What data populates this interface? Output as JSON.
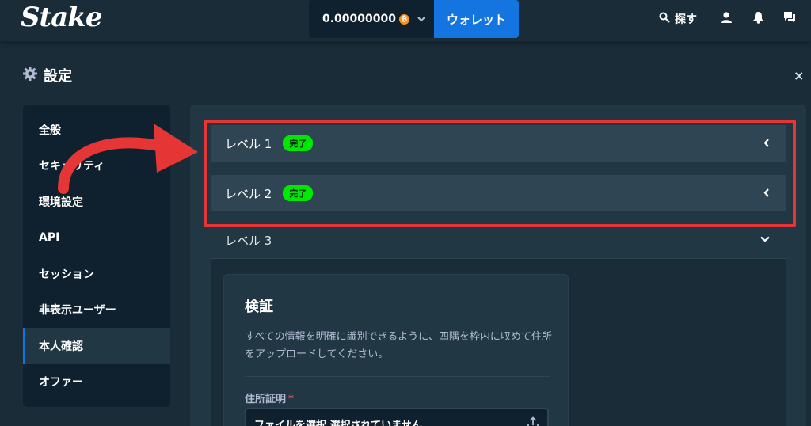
{
  "header": {
    "logo": "Stake",
    "balance": "0.00000000",
    "coin_symbol": "₿",
    "wallet_label": "ウォレット",
    "search_label": "探す"
  },
  "settings": {
    "title": "設定",
    "close": "×"
  },
  "sidebar": {
    "items": [
      {
        "label": "全般"
      },
      {
        "label": "セキュリティ"
      },
      {
        "label": "環境設定"
      },
      {
        "label": "API"
      },
      {
        "label": "セッション"
      },
      {
        "label": "非表示ユーザー"
      },
      {
        "label": "本人確認"
      },
      {
        "label": "オファー"
      }
    ],
    "active_index": 6
  },
  "levels": [
    {
      "label": "レベル 1",
      "badge": "完了"
    },
    {
      "label": "レベル 2",
      "badge": "完了"
    },
    {
      "label": "レベル 3"
    }
  ],
  "verification": {
    "title": "検証",
    "description": "すべての情報を明確に識別できるように、四隅を枠内に収めて住所をアップロードしてください。",
    "field_label": "住所証明",
    "required_mark": "*",
    "file_value": "ファイルを選択 選択されていません"
  },
  "colors": {
    "background": "#1a2c38",
    "panel": "#213743",
    "accent": "#1475e1",
    "success": "#00e701",
    "annotation": "#e53535"
  },
  "icons": [
    "gear-icon",
    "search-icon",
    "user-icon",
    "bell-icon",
    "chat-icon",
    "chevron-down-icon",
    "chevron-left-icon",
    "upload-icon",
    "bitcoin-icon"
  ]
}
